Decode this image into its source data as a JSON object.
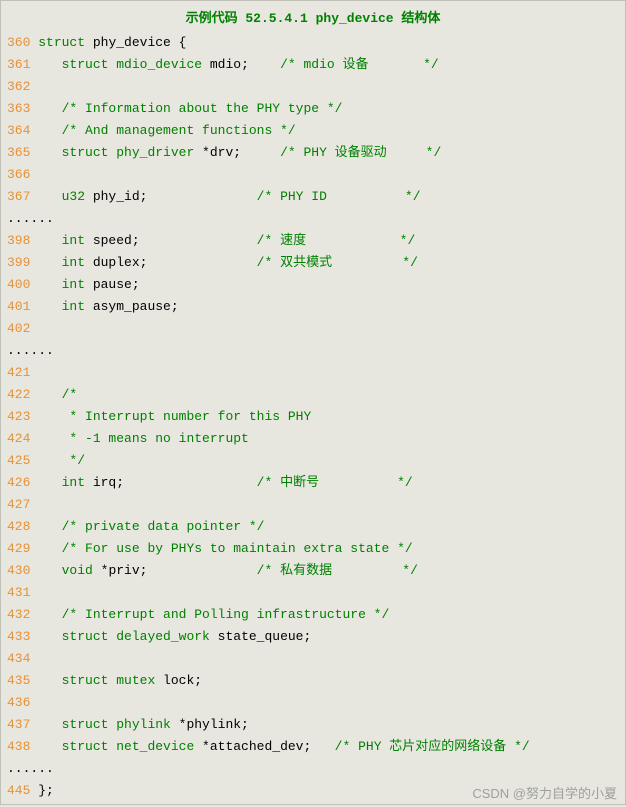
{
  "title": "示例代码 52.5.4.1 phy_device 结构体",
  "watermark": "CSDN @努力自学的小夏",
  "dots": "......",
  "lines": {
    "l360": {
      "n": "360",
      "kw": "struct",
      "id": "phy_device",
      "brace": " {"
    },
    "l361": {
      "n": "361",
      "kw": "struct ",
      "ty": "mdio_device",
      "id": " mdio;",
      "cm": "    /* mdio 设备       */"
    },
    "l362": {
      "n": "362"
    },
    "l363": {
      "n": "363",
      "cm": "/* Information about the PHY type */"
    },
    "l364": {
      "n": "364",
      "cm": "/* And management functions */"
    },
    "l365": {
      "n": "365",
      "kw": "struct ",
      "ty": "phy_driver",
      "id": " *drv;",
      "cm": "     /* PHY 设备驱动     */"
    },
    "l366": {
      "n": "366"
    },
    "l367": {
      "n": "367",
      "ty": "u32",
      "id": " phy_id;",
      "cm": "              /* PHY ID          */"
    },
    "l398": {
      "n": "398",
      "ty": "int",
      "id": " speed;",
      "cm": "               /* 速度            */"
    },
    "l399": {
      "n": "399",
      "ty": "int",
      "id": " duplex;",
      "cm": "              /* 双共模式         */"
    },
    "l400": {
      "n": "400",
      "ty": "int",
      "id": " pause;"
    },
    "l401": {
      "n": "401",
      "ty": "int",
      "id": " asym_pause;"
    },
    "l402": {
      "n": "402"
    },
    "l421": {
      "n": "421"
    },
    "l422": {
      "n": "422",
      "cm": "/*"
    },
    "l423": {
      "n": "423",
      "cm": " * Interrupt number for this PHY"
    },
    "l424": {
      "n": "424",
      "cm": " * -1 means no interrupt"
    },
    "l425": {
      "n": "425",
      "cm": " */"
    },
    "l426": {
      "n": "426",
      "ty": "int",
      "id": " irq;",
      "cm": "                 /* 中断号          */"
    },
    "l427": {
      "n": "427"
    },
    "l428": {
      "n": "428",
      "cm": "/* private data pointer */"
    },
    "l429": {
      "n": "429",
      "cm": "/* For use by PHYs to maintain extra state */"
    },
    "l430": {
      "n": "430",
      "ty": "void",
      "id": " *priv;",
      "cm": "              /* 私有数据         */"
    },
    "l431": {
      "n": "431"
    },
    "l432": {
      "n": "432",
      "cm": "/* Interrupt and Polling infrastructure */"
    },
    "l433": {
      "n": "433",
      "kw": "struct ",
      "ty": "delayed_work",
      "id": " state_queue;"
    },
    "l434": {
      "n": "434"
    },
    "l435": {
      "n": "435",
      "kw": "struct ",
      "ty": "mutex",
      "id": " lock;"
    },
    "l436": {
      "n": "436"
    },
    "l437": {
      "n": "437",
      "kw": "struct ",
      "ty": "phylink",
      "id": " *phylink;"
    },
    "l438": {
      "n": "438",
      "kw": "struct ",
      "ty": "net_device",
      "id": " *attached_dev;",
      "cm": "   /* PHY 芯片对应的网络设备 */"
    },
    "l445": {
      "n": "445",
      "brace": "};"
    }
  }
}
